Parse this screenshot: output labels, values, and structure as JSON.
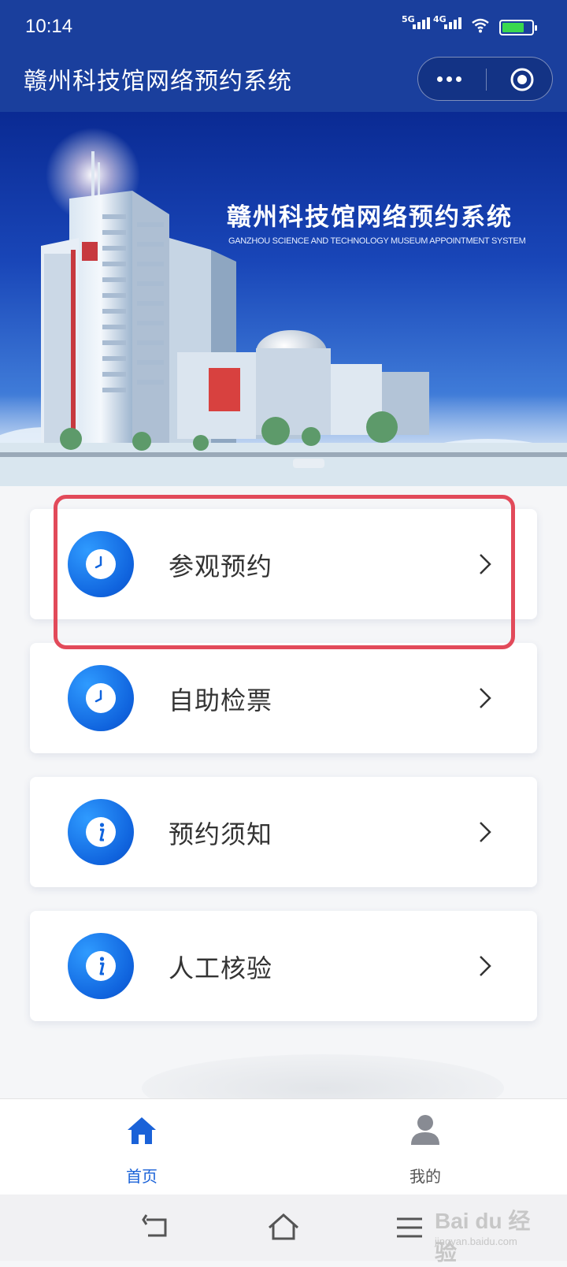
{
  "status_bar": {
    "time": "10:14",
    "signal_1": "5G",
    "signal_2": "4G",
    "battery_level": 0.75
  },
  "nav": {
    "title": "赣州科技馆网络预约系统",
    "more_icon": "more-dots-icon",
    "close_icon": "target-circle-icon"
  },
  "banner": {
    "title": "赣州科技馆网络预约系统",
    "subtitle": "GANZHOU SCIENCE AND TECHNOLOGY MUSEUM  APPOINTMENT SYSTEM"
  },
  "menu": {
    "items": [
      {
        "label": "参观预约",
        "icon": "clock-icon"
      },
      {
        "label": "自助检票",
        "icon": "clock-icon"
      },
      {
        "label": "预约须知",
        "icon": "info-icon"
      },
      {
        "label": "人工核验",
        "icon": "info-icon"
      }
    ],
    "highlighted_index": 0
  },
  "tabbar": {
    "home_label": "首页",
    "me_label": "我的"
  },
  "watermark": {
    "brand": "Bai du 经验",
    "url": "jingyan.baidu.com"
  },
  "colors": {
    "primary": "#1a62d8",
    "nav_bg": "#1a3f9d",
    "highlight": "#e24a5a",
    "page_bg": "#f5f6f8"
  }
}
